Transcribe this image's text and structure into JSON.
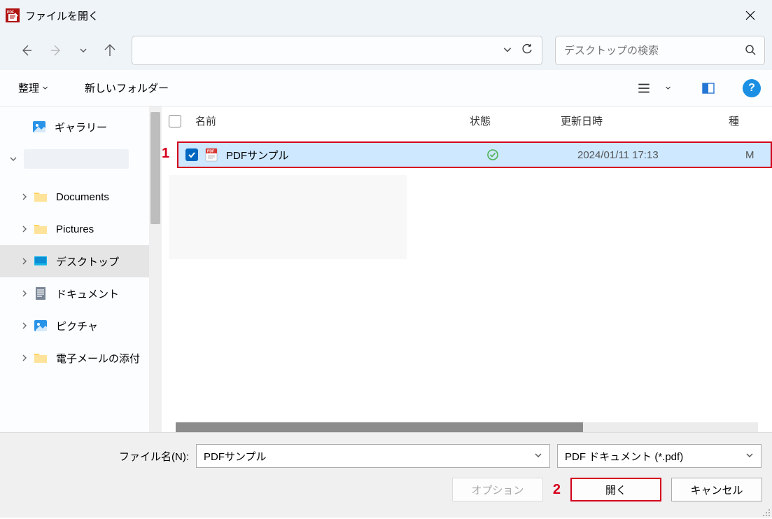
{
  "titlebar": {
    "title": "ファイルを開く"
  },
  "search": {
    "placeholder": "デスクトップの検索"
  },
  "toolbar": {
    "organize": "整理",
    "new_folder": "新しいフォルダー"
  },
  "sidebar": {
    "items": [
      {
        "label": "ギャラリー"
      },
      {
        "label": ""
      },
      {
        "label": "Documents"
      },
      {
        "label": "Pictures"
      },
      {
        "label": "デスクトップ"
      },
      {
        "label": "ドキュメント"
      },
      {
        "label": "ピクチャ"
      },
      {
        "label": "電子メールの添付"
      }
    ]
  },
  "columns": {
    "name": "名前",
    "status": "状態",
    "modified": "更新日時",
    "type": "種"
  },
  "file": {
    "name": "PDFサンプル",
    "modified": "2024/01/11 17:13",
    "type": "M"
  },
  "footer": {
    "filename_label": "ファイル名(N):",
    "filename_value": "PDFサンプル",
    "filetype_value": "PDF ドキュメント (*.pdf)",
    "options": "オプション",
    "open": "開く",
    "cancel": "キャンセル"
  },
  "annotations": {
    "one": "1",
    "two": "2"
  }
}
